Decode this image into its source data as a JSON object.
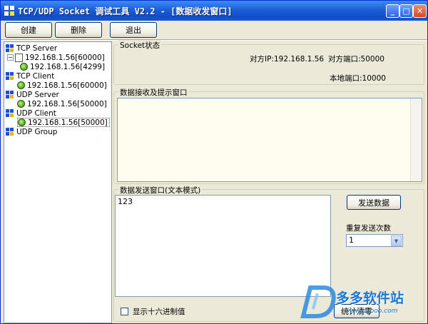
{
  "window": {
    "title": "TCP/UDP Socket 调试工具 V2.2 - [数据收发窗口]",
    "controls": {
      "minimize": "_",
      "maximize": "□",
      "close": "✕"
    }
  },
  "toolbar": {
    "create_label": "创建",
    "delete_label": "删除",
    "exit_label": "退出"
  },
  "tree": {
    "tcp_server": {
      "label": "TCP Server",
      "child": "192.168.1.56[60000]",
      "grandchild": "192.168.1.56[4299]",
      "expander": "−"
    },
    "tcp_client": {
      "label": "TCP Client",
      "child": "192.168.1.56[60000]"
    },
    "udp_server": {
      "label": "UDP Server",
      "child": "192.168.1.56[50000]"
    },
    "udp_client": {
      "label": "UDP Client",
      "child": "192.168.1.56[50000]"
    },
    "udp_group": {
      "label": "UDP Group"
    }
  },
  "socket_status": {
    "title": "Socket状态",
    "peer_ip": "对方IP:192.168.1.56",
    "peer_port": "对方端口:50000",
    "local_port": "本地端口:10000"
  },
  "receive": {
    "title": "数据接收及提示窗口"
  },
  "send": {
    "title": "数据发送窗口(文本模式)",
    "content": "123",
    "send_label": "发送数据",
    "repeat_label": "重复发送次数",
    "repeat_value": "1",
    "hex_label": "显示十六进制值",
    "stats_label": "统计清零"
  },
  "watermark": {
    "text": "多多软件站",
    "sub": "www.ddooo.com"
  },
  "colors": {
    "titlebar": "#0f4ec8",
    "face": "#ece9d8",
    "tree_icon_blue": "#1d4fd8"
  }
}
